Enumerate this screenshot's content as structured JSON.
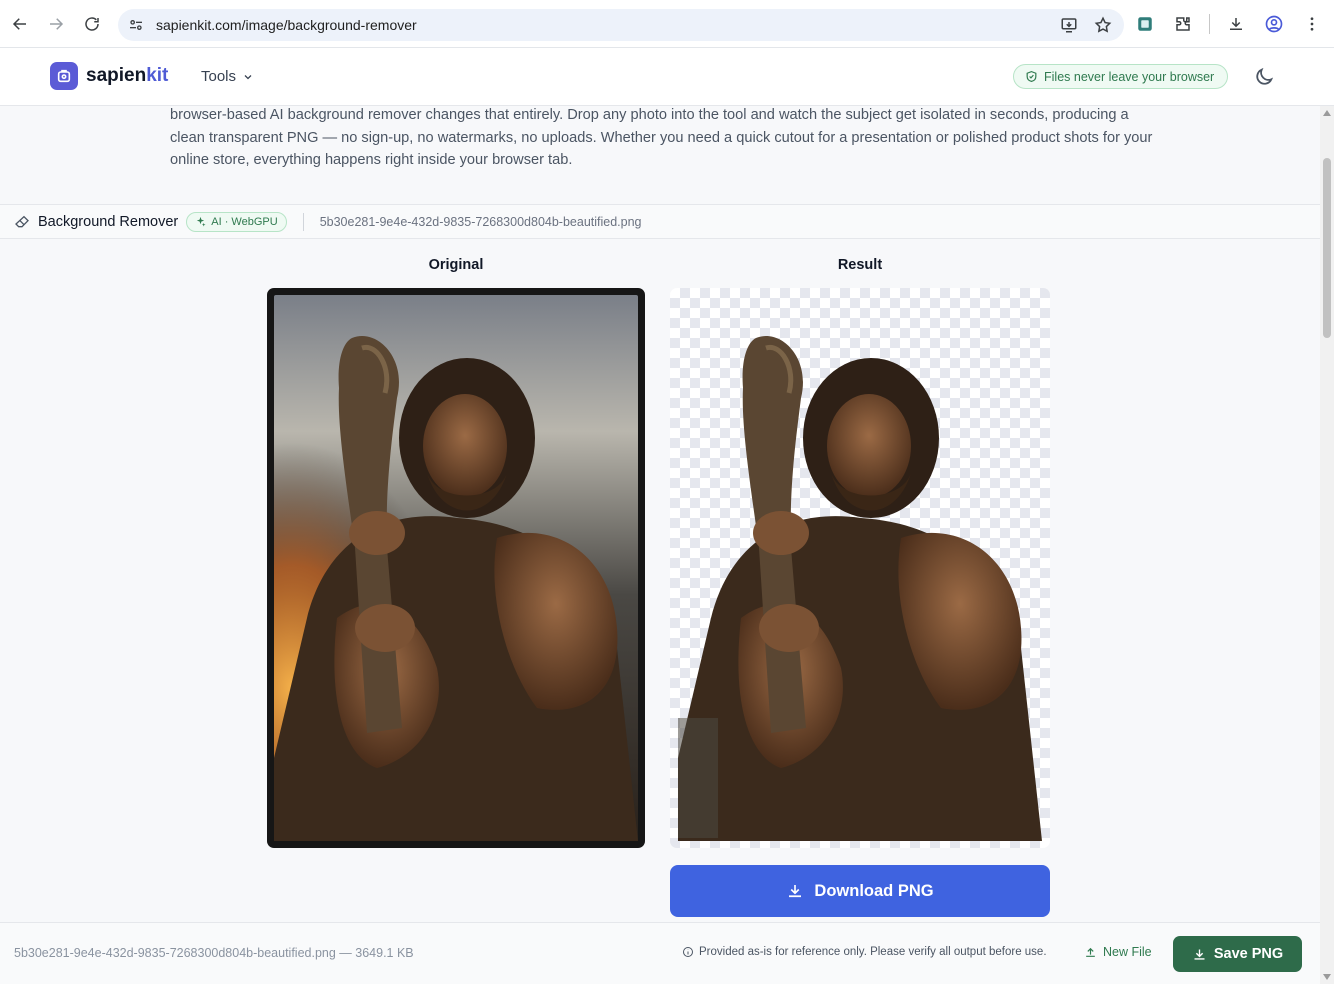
{
  "browser": {
    "url": "sapienkit.com/image/background-remover",
    "icons": [
      "back-icon",
      "forward-icon",
      "reload-icon",
      "site-settings-icon",
      "install-app-icon",
      "bookmark-star-icon",
      "extension-icon",
      "puzzle-icon",
      "downloads-icon",
      "profile-icon",
      "kebab-menu-icon"
    ]
  },
  "header": {
    "brand_main": "sapien",
    "brand_accent": "kit",
    "tools_label": "Tools",
    "privacy_badge": "Files never leave your browser"
  },
  "intro_text": "browser-based AI background remover changes that entirely. Drop any photo into the tool and watch the subject get isolated in seconds, producing a clean transparent PNG — no sign-up, no watermarks, no uploads. Whether you need a quick cutout for a presentation or polished product shots for your online store, everything happens right inside your browser tab.",
  "tool": {
    "name": "Background Remover",
    "badge": "AI · WebGPU",
    "file_name": "5b30e281-9e4e-432d-9835-7268300d804b-beautified.png"
  },
  "workspace": {
    "original_label": "Original",
    "result_label": "Result",
    "download_label": "Download PNG"
  },
  "footer": {
    "file_meta": "5b30e281-9e4e-432d-9835-7268300d804b-beautified.png — 3649.1 KB",
    "disclaimer": "Provided as-is for reference only. Please verify all output before use.",
    "new_file_label": "New File",
    "save_label": "Save PNG"
  },
  "colors": {
    "brand": "#5b5bd6",
    "primary_button": "#3f63e0",
    "save_button": "#2e6b4a",
    "badge_green": "#2f7a4f"
  }
}
